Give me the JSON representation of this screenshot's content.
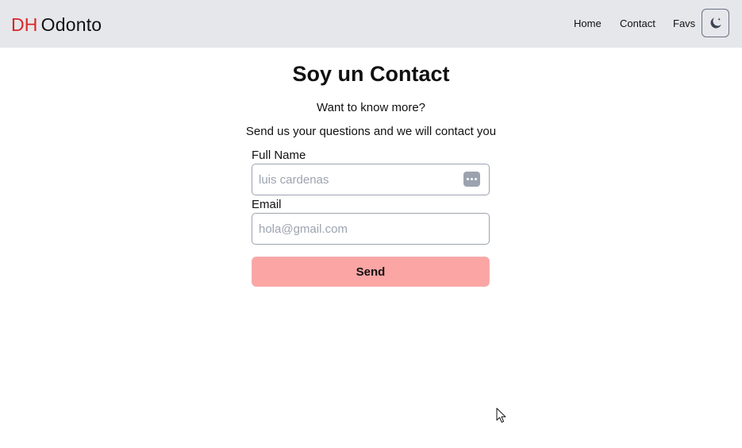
{
  "navbar": {
    "brand_prefix": "DH",
    "brand_name": "Odonto",
    "links": [
      "Home",
      "Contact",
      "Favs"
    ],
    "theme_toggle_icon": "moon-icon"
  },
  "page": {
    "title": "Soy un Contact",
    "subtitle_1": "Want to know more?",
    "subtitle_2": "Send us your questions and we will contact you"
  },
  "form": {
    "name_label": "Full Name",
    "name_placeholder": "luis cardenas",
    "name_value": "",
    "email_label": "Email",
    "email_placeholder": "hola@gmail.com",
    "email_value": "",
    "submit_label": "Send",
    "autofill_icon": "password-autofill-icon"
  },
  "colors": {
    "navbar_bg": "#e5e7eb",
    "brand_accent": "#dc2626",
    "button_bg": "#fca5a5"
  }
}
